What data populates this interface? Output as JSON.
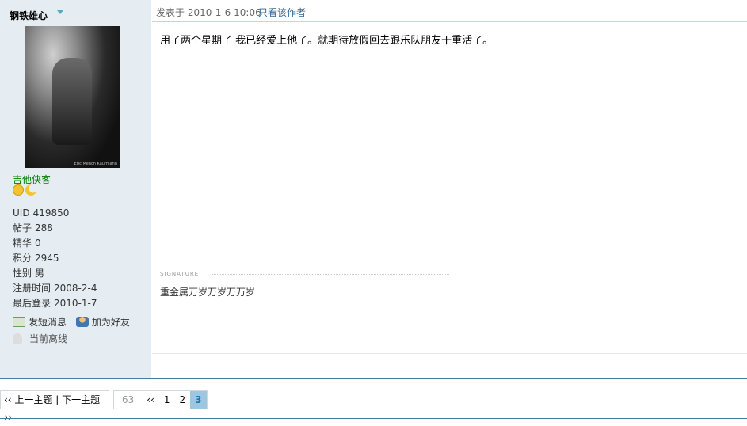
{
  "author": {
    "name": "钢铁雄心",
    "avatar_caption": "Eric Mench Kaufmann",
    "title": "吉他侠客",
    "stats": [
      {
        "key": "UID",
        "value": "419850"
      },
      {
        "key": "帖子",
        "value": "288"
      },
      {
        "key": "精华",
        "value": "0"
      },
      {
        "key": "积分",
        "value": "2945"
      },
      {
        "key": "性别",
        "value": "男"
      },
      {
        "key": "注册时间",
        "value": "2008-2-4"
      },
      {
        "key": "最后登录",
        "value": "2010-1-7"
      }
    ],
    "actions": {
      "send_message": "发短消息",
      "add_friend": "加为好友"
    },
    "status": "当前离线",
    "rank_icons": [
      "sun-icon",
      "moon-icon"
    ]
  },
  "post": {
    "posted_label": "发表于",
    "posted_time": "2010-1-6 10:06",
    "only_author": "只看该作者",
    "content": "用了两个星期了 我已经爱上他了。就期待放假回去跟乐队朋友干重活了。",
    "signature_label": "SIGNATURE:",
    "signature": "重金属万岁万岁万万岁"
  },
  "nav": {
    "prev_next": "‹‹ 上一主题 | 下一主题 ››"
  },
  "pager": {
    "total": "63",
    "first": "‹‹",
    "pages": [
      "1",
      "2"
    ],
    "current": "3"
  },
  "colors": {
    "sidebar_bg": "#e5edf2",
    "link": "#336699",
    "title_green": "#008000",
    "accent_line": "#3e7fa6",
    "current_page_bg": "#9ec7df"
  }
}
